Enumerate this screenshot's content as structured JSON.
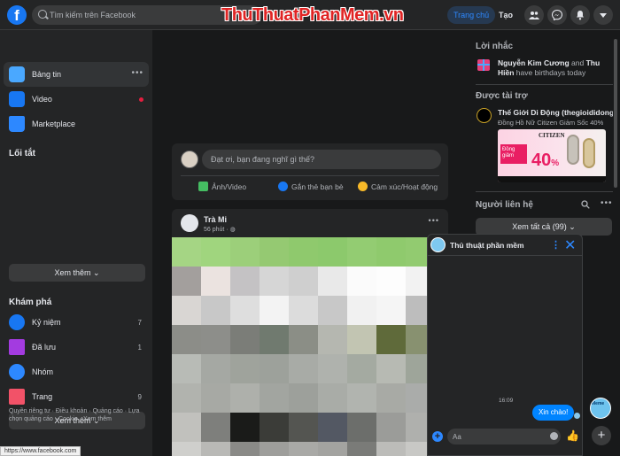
{
  "topbar": {
    "search_placeholder": "Tìm kiếm trên Facebook",
    "watermark": "ThuThuatPhanMem.vn",
    "home_label": "Trang chủ",
    "create_label": "Tạo"
  },
  "sidebar": {
    "items": [
      {
        "label": "Bảng tin"
      },
      {
        "label": "Video"
      },
      {
        "label": "Marketplace"
      }
    ],
    "shortcuts_title": "Lối tắt",
    "see_more": "Xem thêm",
    "explore_title": "Khám phá",
    "explore": [
      {
        "label": "Kỷ niệm",
        "count": "7"
      },
      {
        "label": "Đã lưu",
        "count": "1"
      },
      {
        "label": "Nhóm",
        "count": ""
      },
      {
        "label": "Trang",
        "count": "9"
      }
    ],
    "see_more_2": "Xem thêm",
    "footer": "Quyền riêng tư · Điều khoản · Quảng cáo · Lựa chọn quảng cáo · Cookie · Xem thêm",
    "url_tooltip": "https://www.facebook.com"
  },
  "composer": {
    "placeholder": "Đạt ơi, bạn đang nghĩ gì thế?",
    "actions": [
      "Ảnh/Video",
      "Gắn thẻ bạn bè",
      "Cảm xúc/Hoạt động"
    ]
  },
  "post": {
    "author": "Trà Mi",
    "time": "56 phút · "
  },
  "right": {
    "reminders_title": "Lời nhắc",
    "birthday_name1": "Nguyễn Kim Cương",
    "birthday_and": " and ",
    "birthday_name2": "Thu Hiền",
    "birthday_text": " have birthdays today",
    "sponsored_title": "Được tài trợ",
    "ad_title": "Thế Giới Di Động (thegioididong.com)",
    "ad_sub": "Đồng Hồ Nữ Citizen Giảm Sốc 40%",
    "ad_brand": "CITIZEN",
    "ad_pct": "40",
    "ad_tag": "Đồng giảm",
    "contacts_title": "Người liên hệ",
    "see_all": "Xem tất cả (99)"
  },
  "chat": {
    "title": "Thủ thuật phần mềm",
    "time": "16:09",
    "message": "Xin chào!",
    "input_placeholder": "Aa",
    "bubble_label": "Meme"
  },
  "colors": {
    "accent": "#2d88ff",
    "brand": "#1877f2",
    "background": "#18191a",
    "surface": "#242526"
  }
}
